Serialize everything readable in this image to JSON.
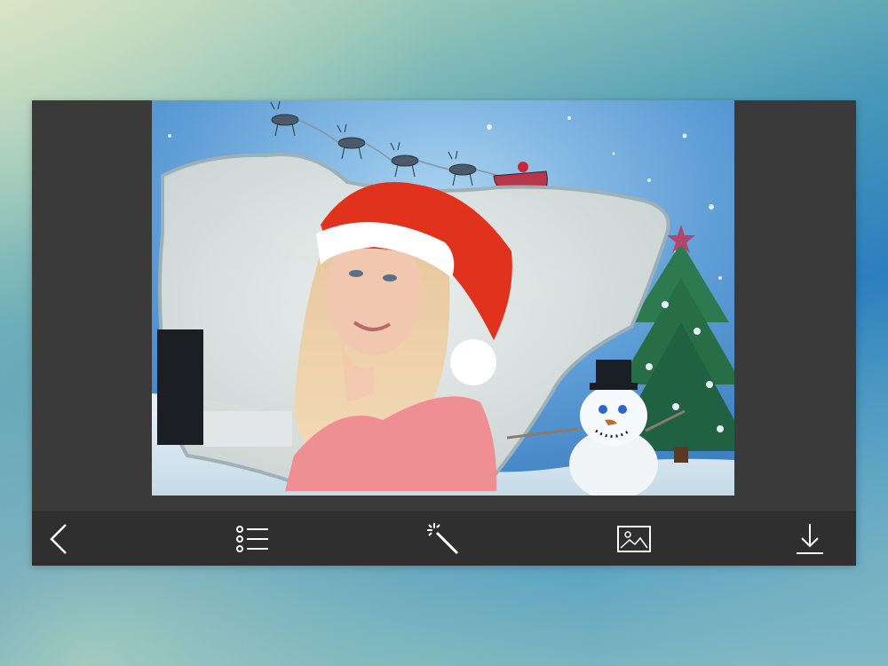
{
  "colors": {
    "panel": "#3a3a3a",
    "toolbar": "#2f2f2f",
    "icon": "#ffffff",
    "hat_red": "#e0321c",
    "sweater": "#ef8f93"
  },
  "editor": {
    "photo": "christmas-frame-photo",
    "frame_theme": "snowman-santa-sleigh"
  },
  "toolbar": {
    "items": [
      {
        "name": "back",
        "icon": "chevron-left-icon"
      },
      {
        "name": "frames-list",
        "icon": "list-icon"
      },
      {
        "name": "effects",
        "icon": "magic-wand-icon"
      },
      {
        "name": "gallery",
        "icon": "image-icon"
      },
      {
        "name": "save",
        "icon": "download-icon"
      }
    ]
  }
}
